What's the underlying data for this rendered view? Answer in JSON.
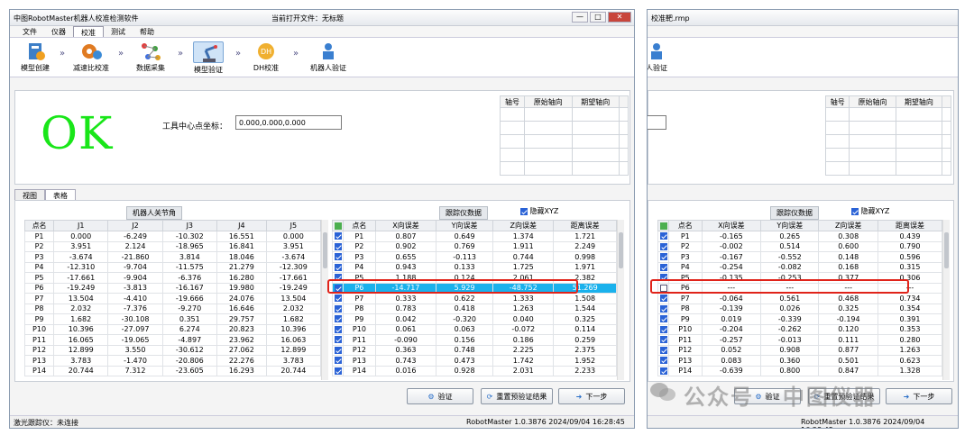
{
  "left": {
    "title": "中图RobotMaster机器人校准检测软件",
    "current_file": "当前打开文件：无标题",
    "menu": [
      "文件",
      "仪器",
      "校准",
      "测试",
      "帮助"
    ],
    "tools": [
      "模型创建",
      "减速比校准",
      "数据采集",
      "模型验证",
      "DH校准",
      "机器人验证"
    ],
    "ok_text": "OK",
    "tcp_label": "工具中心点坐标：",
    "tcp_value": "0.000,0.000,0.000",
    "axis_headers": [
      "轴号",
      "原始轴向",
      "期望轴向"
    ],
    "tabs": [
      "视图",
      "表格"
    ],
    "robot_section": "机器人关节角",
    "tracker_section": "跟踪仪数据",
    "hide_xyz": "隐藏XYZ",
    "robot_headers": [
      "点名",
      "J1",
      "J2",
      "J3",
      "J4",
      "J5"
    ],
    "robot_rows": [
      [
        "P1",
        "0.000",
        "-6.249",
        "-10.302",
        "16.551",
        "0.000"
      ],
      [
        "P2",
        "3.951",
        "2.124",
        "-18.965",
        "16.841",
        "3.951"
      ],
      [
        "P3",
        "-3.674",
        "-21.860",
        "3.814",
        "18.046",
        "-3.674"
      ],
      [
        "P4",
        "-12.310",
        "-9.704",
        "-11.575",
        "21.279",
        "-12.309"
      ],
      [
        "P5",
        "-17.661",
        "-9.904",
        "-6.376",
        "16.280",
        "-17.661"
      ],
      [
        "P6",
        "-19.249",
        "-3.813",
        "-16.167",
        "19.980",
        "-19.249"
      ],
      [
        "P7",
        "13.504",
        "-4.410",
        "-19.666",
        "24.076",
        "13.504"
      ],
      [
        "P8",
        "2.032",
        "-7.376",
        "-9.270",
        "16.646",
        "2.032"
      ],
      [
        "P9",
        "1.682",
        "-30.108",
        "0.351",
        "29.757",
        "1.682"
      ],
      [
        "P10",
        "10.396",
        "-27.097",
        "6.274",
        "20.823",
        "10.396"
      ],
      [
        "P11",
        "16.065",
        "-19.065",
        "-4.897",
        "23.962",
        "16.063"
      ],
      [
        "P12",
        "12.899",
        "3.550",
        "-30.612",
        "27.062",
        "12.899"
      ],
      [
        "P13",
        "3.783",
        "-1.470",
        "-20.806",
        "22.276",
        "3.783"
      ],
      [
        "P14",
        "20.744",
        "7.312",
        "-23.605",
        "16.293",
        "20.744"
      ]
    ],
    "tracker_headers": [
      "点名",
      "X向误差",
      "Y向误差",
      "Z向误差",
      "距离误差"
    ],
    "tracker_rows": [
      [
        "P1",
        "0.807",
        "0.649",
        "1.374",
        "1.721"
      ],
      [
        "P2",
        "0.902",
        "0.769",
        "1.911",
        "2.249"
      ],
      [
        "P3",
        "0.655",
        "-0.113",
        "0.744",
        "0.998"
      ],
      [
        "P4",
        "0.943",
        "0.133",
        "1.725",
        "1.971"
      ],
      [
        "P5",
        "1.188",
        "0.124",
        "2.061",
        "2.382"
      ],
      [
        "P6",
        "-14.717",
        "5.929",
        "-48.752",
        "51.269"
      ],
      [
        "P7",
        "0.333",
        "0.622",
        "1.333",
        "1.508"
      ],
      [
        "P8",
        "0.783",
        "0.418",
        "1.263",
        "1.544"
      ],
      [
        "P9",
        "0.042",
        "-0.320",
        "0.040",
        "0.325"
      ],
      [
        "P10",
        "0.061",
        "0.063",
        "-0.072",
        "0.114"
      ],
      [
        "P11",
        "-0.090",
        "0.156",
        "0.186",
        "0.259"
      ],
      [
        "P12",
        "0.363",
        "0.748",
        "2.225",
        "2.375"
      ],
      [
        "P13",
        "0.743",
        "0.473",
        "1.742",
        "1.952"
      ],
      [
        "P14",
        "0.016",
        "0.928",
        "2.031",
        "2.233"
      ]
    ],
    "buttons": [
      "验证",
      "重置预验证结果",
      "下一步"
    ],
    "status_left": "激光跟踪仪：未连接",
    "status_right": "RobotMaster 1.0.3876 2024/09/04 16:28:45"
  },
  "right": {
    "title_fragment": "校准靶.rmp",
    "tool_fragment": "人验证",
    "axis_headers": [
      "轴号",
      "原始轴向",
      "期望轴向"
    ],
    "tracker_section": "跟踪仪数据",
    "hide_xyz": "隐藏XYZ",
    "tracker_headers": [
      "点名",
      "X向误差",
      "Y向误差",
      "Z向误差",
      "距离误差"
    ],
    "tracker_rows": [
      [
        "P1",
        "-0.165",
        "0.265",
        "0.308",
        "0.439"
      ],
      [
        "P2",
        "-0.002",
        "0.514",
        "0.600",
        "0.790"
      ],
      [
        "P3",
        "-0.167",
        "-0.552",
        "0.148",
        "0.596"
      ],
      [
        "P4",
        "-0.254",
        "-0.082",
        "0.168",
        "0.315"
      ],
      [
        "P5",
        "-0.135",
        "-0.253",
        "0.377",
        "0.306"
      ],
      [
        "P6",
        "---",
        "---",
        "---",
        "---"
      ],
      [
        "P7",
        "-0.064",
        "0.561",
        "0.468",
        "0.734"
      ],
      [
        "P8",
        "-0.139",
        "0.026",
        "0.325",
        "0.354"
      ],
      [
        "P9",
        "0.019",
        "-0.339",
        "-0.194",
        "0.391"
      ],
      [
        "P10",
        "-0.204",
        "-0.262",
        "0.120",
        "0.353"
      ],
      [
        "P11",
        "-0.257",
        "-0.013",
        "0.111",
        "0.280"
      ],
      [
        "P12",
        "0.052",
        "0.908",
        "0.877",
        "1.263"
      ],
      [
        "P13",
        "0.083",
        "0.360",
        "0.501",
        "0.623"
      ],
      [
        "P14",
        "-0.639",
        "0.800",
        "0.847",
        "1.328"
      ]
    ],
    "buttons": [
      "验证",
      "重置预验证结果",
      "下一步"
    ],
    "status_right": "RobotMaster 1.0.3876 2024/09/04 16:28:45"
  },
  "watermark": "公众号 · 中图仪器",
  "colors": {
    "ok_green": "#19e619",
    "highlight": "#1ab1ec",
    "annotation_red": "#e0231a"
  }
}
